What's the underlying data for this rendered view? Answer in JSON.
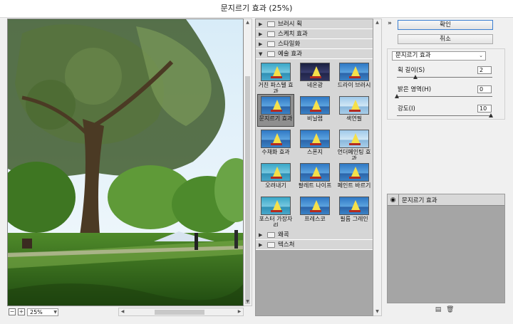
{
  "window": {
    "title": "문지르기 효과 (25%)"
  },
  "preview": {
    "zoom": "25%",
    "zoom_out": "−",
    "zoom_in": "+"
  },
  "gallery": {
    "folders_before": [
      {
        "label": "브러시 획",
        "expanded": false
      },
      {
        "label": "스케치 효과",
        "expanded": false
      },
      {
        "label": "스타일화",
        "expanded": false
      }
    ],
    "open_folder": {
      "label": "예술 효과",
      "expanded": true
    },
    "filters": [
      {
        "label": "거친 파스텔 효과",
        "style": "teal",
        "selected": false
      },
      {
        "label": "네온광",
        "style": "dark",
        "selected": false
      },
      {
        "label": "드라이 브러시",
        "style": "blue",
        "selected": false
      },
      {
        "label": "문지르기 효과",
        "style": "blue",
        "selected": true
      },
      {
        "label": "비닐랩",
        "style": "blue",
        "selected": false
      },
      {
        "label": "색연필",
        "style": "pale",
        "selected": false
      },
      {
        "label": "수채화 효과",
        "style": "blue",
        "selected": false
      },
      {
        "label": "스폰지",
        "style": "blue",
        "selected": false
      },
      {
        "label": "언더페인팅 효과",
        "style": "pale",
        "selected": false
      },
      {
        "label": "오려내기",
        "style": "teal",
        "selected": false
      },
      {
        "label": "팔레트 나이프",
        "style": "blue",
        "selected": false
      },
      {
        "label": "페인트 바르기",
        "style": "blue",
        "selected": false
      },
      {
        "label": "포스터 가장자리",
        "style": "teal",
        "selected": false
      },
      {
        "label": "프레스코",
        "style": "blue",
        "selected": false
      },
      {
        "label": "필름 그레인",
        "style": "blue",
        "selected": false
      }
    ],
    "folders_after": [
      {
        "label": "왜곡",
        "expanded": false
      },
      {
        "label": "텍스처",
        "expanded": false
      }
    ]
  },
  "actions": {
    "ok_label": "확인",
    "cancel_label": "취소"
  },
  "settings": {
    "filter_name": "문지르기 효과",
    "params": [
      {
        "label": "획 길이(S)",
        "value": "2",
        "knob_fraction": 0.2
      },
      {
        "label": "밝은 영역(H)",
        "value": "0",
        "knob_fraction": 0.0
      },
      {
        "label": "강도(I)",
        "value": "10",
        "knob_fraction": 1.0
      }
    ]
  },
  "layers": {
    "items": [
      {
        "name": "문지르기 효과",
        "visible": true
      }
    ]
  },
  "icons": {
    "collapse": "double-chevron-up-icon",
    "eye": "eye-icon",
    "new_layer": "new-effect-layer-icon",
    "delete": "trash-icon"
  },
  "colors": {
    "gallery_bg": "#a7a7a7",
    "accent": "#3c7fd1"
  }
}
